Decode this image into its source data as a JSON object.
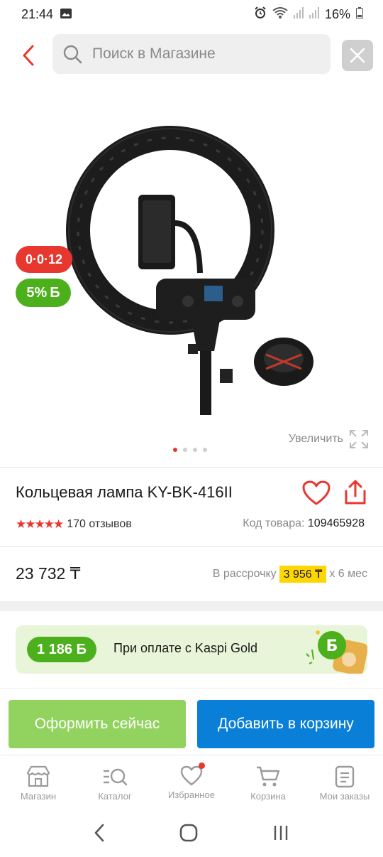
{
  "status_bar": {
    "time": "21:44",
    "battery": "16%",
    "icons": [
      "image-icon",
      "alarm-icon",
      "wifi-icon",
      "signal-icon",
      "signal-icon",
      "battery-icon"
    ]
  },
  "header": {
    "search_placeholder": "Поиск в Магазине"
  },
  "gallery": {
    "badge_installment": "0·0·12",
    "badge_bonus": "5%",
    "badge_bonus_symbol": "Б",
    "zoom_label": "Увеличить",
    "dots_count": 4,
    "active_dot": 0
  },
  "product": {
    "title": "Кольцевая лампа KY-BK-416II",
    "reviews": "170 отзывов",
    "rating_stars": 5,
    "sku_label": "Код товара:",
    "sku_value": "109465928",
    "price": "23 732 ₸",
    "installment_prefix": "В рассрочку",
    "installment_amount": "3 956 ₸",
    "installment_suffix": "x 6 мес"
  },
  "kaspi_gold": {
    "bonus": "1 186 Б",
    "text": "При оплате с Kaspi Gold"
  },
  "actions": {
    "checkout": "Оформить сейчас",
    "add_to_cart": "Добавить в корзину"
  },
  "bottom_nav": [
    {
      "label": "Магазин",
      "icon": "store-icon"
    },
    {
      "label": "Каталог",
      "icon": "catalog-icon"
    },
    {
      "label": "Избранное",
      "icon": "heart-icon"
    },
    {
      "label": "Корзина",
      "icon": "cart-icon"
    },
    {
      "label": "Мои заказы",
      "icon": "orders-icon"
    }
  ],
  "colors": {
    "accent_red": "#e8372f",
    "bonus_green": "#4caf1c",
    "checkout_green": "#92d35f",
    "cart_blue": "#0a7fd8",
    "installment_yellow": "#ffd700"
  }
}
